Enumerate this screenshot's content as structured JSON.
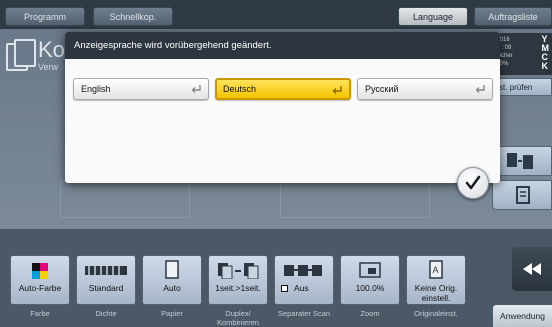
{
  "topbar": {
    "tabs": [
      {
        "label": "Programm"
      },
      {
        "label": "Schnellkop."
      },
      {
        "label": "Language"
      },
      {
        "label": "Auftragsliste"
      }
    ]
  },
  "background": {
    "title": "Kop",
    "subtitle": "Verw",
    "status": {
      "line1": "/ 2016",
      "line2": "13 : 09",
      "line3": "peicher",
      "line4": "100%"
    },
    "toner_letters": [
      "Y",
      "M",
      "C",
      "K"
    ],
    "side_label": "st. prüfen"
  },
  "dialog": {
    "message": "Anzeigesprache wird vorübergehend geändert.",
    "languages": [
      {
        "label": "English",
        "selected": false
      },
      {
        "label": "Deutsch",
        "selected": true
      },
      {
        "label": "Русский",
        "selected": false
      }
    ]
  },
  "functions": [
    {
      "value": "Auto-Farbe",
      "caption": "Farbe"
    },
    {
      "value": "Standard",
      "caption": "Dichte"
    },
    {
      "value": "Auto",
      "caption": "Papier"
    },
    {
      "value": "1seit.>1seit.",
      "caption": "Duplex/ Kombinieren"
    },
    {
      "value": "Aus",
      "caption": "Separater Scan"
    },
    {
      "value": "100.0%",
      "caption": "Zoom"
    },
    {
      "value": "Keine Orig. einstell.",
      "caption": "Originaleinst."
    }
  ],
  "anwendung_label": "Anwendung",
  "colors": {
    "selected": "#f5c400",
    "header": "#2d3640",
    "panel": "#6a7989"
  }
}
